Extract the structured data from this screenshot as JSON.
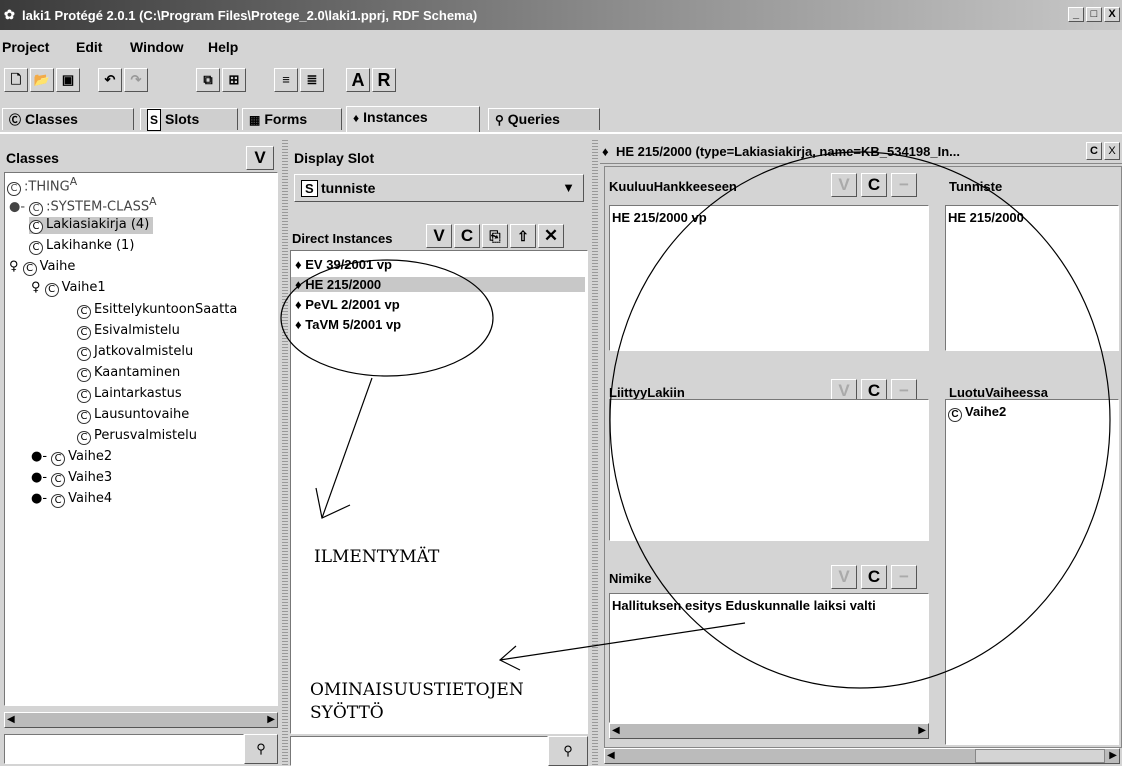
{
  "window": {
    "title": "laki1  Protégé 2.0.1    (C:\\Program Files\\Protege_2.0\\laki1.pprj, RDF Schema)",
    "controls": [
      "_",
      "□",
      "X"
    ]
  },
  "menu": [
    "Project",
    "Edit",
    "Window",
    "Help"
  ],
  "toolbar": {
    "icons": [
      "new-file-icon",
      "open-folder-icon",
      "save-icon",
      "undo-icon",
      "redo-icon",
      "cascade-windows-icon",
      "tile-windows-icon",
      "insert-slot-icon",
      "insert-slot-all-icon"
    ],
    "letters": [
      "A",
      "R"
    ]
  },
  "tabs": [
    {
      "label": "Classes",
      "icon": "Ⓒ"
    },
    {
      "label": "Slots",
      "icon": "S"
    },
    {
      "label": "Forms",
      "icon": "▦"
    },
    {
      "label": "Instances",
      "icon": "♦"
    },
    {
      "label": "Queries",
      "icon": "⚲"
    }
  ],
  "classes_panel": {
    "header": "Classes",
    "header_button": "V",
    "tree": [
      {
        "label": ":THING",
        "mark": "A"
      },
      {
        "label": ":SYSTEM-CLASS",
        "mark": "A"
      },
      {
        "label": "Lakiasiakirja  (4)",
        "selected": true
      },
      {
        "label": "Lakihanke  (1)"
      },
      {
        "label": "Vaihe"
      },
      {
        "label": "Vaihe1"
      },
      {
        "label": "EsittelykuntoonSaatta"
      },
      {
        "label": "Esivalmistelu"
      },
      {
        "label": "Jatkovalmistelu"
      },
      {
        "label": "Kaantaminen"
      },
      {
        "label": "Laintarkastus"
      },
      {
        "label": "Lausuntovaihe"
      },
      {
        "label": "Perusvalmistelu"
      },
      {
        "label": "Vaihe2"
      },
      {
        "label": "Vaihe3"
      },
      {
        "label": "Vaihe4"
      }
    ]
  },
  "instances_panel": {
    "display_slot_label": "Display Slot",
    "display_slot_value": "tunniste",
    "direct_instances_label": "Direct Instances",
    "buttons": [
      "V",
      "C",
      "⎘",
      "⇧",
      "✕"
    ],
    "items": [
      "EV 39/2001 vp",
      "HE 215/2000",
      "PeVL 2/2001 vp",
      "TaVM 5/2001 vp"
    ],
    "selected_index": 1
  },
  "form_panel": {
    "header": "HE 215/2000     (type=Lakiasiakirja, name=KB_534198_In...",
    "header_buttons": [
      "C",
      "X"
    ],
    "fields": {
      "kuuluu": {
        "label": "KuuluuHankkeeseen",
        "value": "HE 215/2000 vp"
      },
      "tunniste": {
        "label": "Tunniste",
        "value": "HE 215/2000"
      },
      "liittyy": {
        "label": "LiittyyLakiin",
        "value": ""
      },
      "luotu": {
        "label": "LuotuVaiheessa",
        "value": "Vaihe2"
      },
      "nimike": {
        "label": "Nimike",
        "value": "Hallituksen esitys Eduskunnalle laiksi valti"
      }
    },
    "field_buttons": [
      "V",
      "C",
      "−"
    ]
  },
  "annotations": {
    "instances_note": "ILMENTYMÄT",
    "input_note_line1": "OMINAISUUSTIETOJEN",
    "input_note_line2": "SYÖTTÖ"
  },
  "colors": {
    "selection": "#c8c8c8",
    "background": "#d4d4d4"
  }
}
